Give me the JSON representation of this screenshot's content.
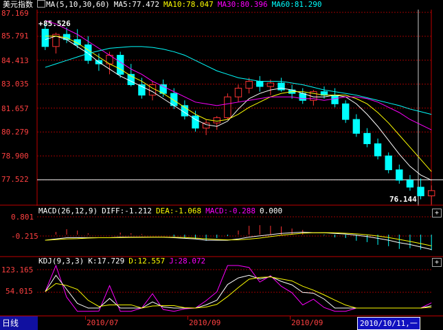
{
  "main_panel": {
    "title": "美元指数",
    "ma_label": "MA(5,10,30,60)",
    "ma5": "MA5:77.472",
    "ma10": "MA10:78.047",
    "ma30": "MA30:80.396",
    "ma60": "MA60:81.290",
    "y_ticks": [
      "87.169",
      "85.791",
      "84.413",
      "83.035",
      "81.657",
      "80.279",
      "78.900",
      "77.522"
    ],
    "high_label": "85.526",
    "last_label": "76.144",
    "current_value": 77.522
  },
  "macd_panel": {
    "label": "MACD(26,12,9)",
    "diff": "DIFF:-1.212",
    "dea": "DEA:-1.068",
    "macd": "MACD:-0.288",
    "extra": "0.000",
    "y_ticks": [
      "0.801",
      "-0.215"
    ]
  },
  "kdj_panel": {
    "label": "KDJ(9,3,3)",
    "k": "K:17.729",
    "d": "D:12.557",
    "j": "J:28.072",
    "y_ticks": [
      "123.165",
      "54.015"
    ]
  },
  "bottom_bar": {
    "period": "日线",
    "dates": [
      "2010/07",
      "2010/09",
      "2010/09"
    ],
    "cursor_date": "2010/10/11,一"
  },
  "controls": {
    "plus1": "+",
    "plus2": "+"
  },
  "colors": {
    "up": "#ff3333",
    "down": "#00ffff",
    "ma5": "#ffffff",
    "ma10": "#ffff00",
    "ma30": "#ff00ff",
    "ma60": "#00ffff",
    "grid": "#a00000",
    "axis": "#c00000"
  },
  "chart_data": {
    "type": "candlestick",
    "series": [
      {
        "name": "MA5",
        "values": [
          85.6,
          85.8,
          85.6,
          85.2,
          84.8,
          84.3,
          83.9,
          83.5,
          83.2,
          82.9,
          82.6,
          82.2,
          81.8,
          81.4,
          81.0,
          80.7,
          80.6,
          80.9,
          81.6,
          82.2,
          82.5,
          82.7,
          82.8,
          82.7,
          82.5,
          82.3,
          82.3,
          82.4,
          82.3,
          81.9,
          81.3,
          80.6,
          79.8,
          79.0,
          78.3,
          77.8,
          77.5
        ]
      },
      {
        "name": "MA10",
        "values": [
          85.8,
          85.8,
          85.7,
          85.4,
          85.0,
          84.6,
          84.2,
          83.9,
          83.5,
          83.2,
          82.8,
          82.5,
          82.1,
          81.7,
          81.3,
          81.0,
          80.9,
          81.0,
          81.3,
          81.7,
          82.0,
          82.3,
          82.5,
          82.6,
          82.6,
          82.5,
          82.4,
          82.4,
          82.4,
          82.2,
          81.9,
          81.4,
          80.8,
          80.1,
          79.4,
          78.7,
          78.0
        ]
      },
      {
        "name": "MA30",
        "values": [
          86.7,
          86.5,
          86.2,
          85.9,
          85.5,
          85.1,
          84.7,
          84.3,
          83.9,
          83.6,
          83.2,
          82.9,
          82.6,
          82.3,
          82.0,
          81.9,
          81.8,
          81.9,
          82.0,
          82.1,
          82.2,
          82.3,
          82.3,
          82.3,
          82.2,
          82.2,
          82.1,
          82.2,
          82.3,
          82.3,
          82.2,
          82.0,
          81.7,
          81.4,
          81.0,
          80.7,
          80.4
        ]
      },
      {
        "name": "MA60",
        "values": [
          84.0,
          84.2,
          84.4,
          84.6,
          84.8,
          84.95,
          85.1,
          85.15,
          85.2,
          85.2,
          85.15,
          85.05,
          84.9,
          84.7,
          84.4,
          84.1,
          83.8,
          83.6,
          83.4,
          83.3,
          83.2,
          83.2,
          83.2,
          83.1,
          83.0,
          82.85,
          82.7,
          82.6,
          82.5,
          82.4,
          82.25,
          82.1,
          81.95,
          81.8,
          81.6,
          81.45,
          81.29
        ]
      }
    ],
    "candles": [
      [
        86.2,
        86.5,
        85.0,
        85.2
      ],
      [
        85.2,
        86.0,
        84.8,
        85.9
      ],
      [
        85.9,
        86.3,
        85.4,
        85.6
      ],
      [
        85.6,
        86.2,
        85.1,
        85.3
      ],
      [
        85.3,
        85.8,
        84.2,
        84.4
      ],
      [
        84.4,
        84.8,
        83.8,
        84.2
      ],
      [
        84.2,
        84.9,
        83.6,
        84.7
      ],
      [
        84.7,
        84.9,
        83.4,
        83.6
      ],
      [
        83.6,
        84.2,
        82.9,
        83.0
      ],
      [
        83.0,
        83.4,
        82.2,
        82.4
      ],
      [
        82.4,
        83.2,
        82.1,
        83.0
      ],
      [
        83.0,
        83.3,
        82.3,
        82.5
      ],
      [
        82.5,
        82.8,
        81.6,
        81.8
      ],
      [
        81.8,
        82.1,
        81.0,
        81.2
      ],
      [
        81.2,
        81.5,
        80.3,
        80.5
      ],
      [
        80.5,
        81.0,
        80.1,
        80.8
      ],
      [
        80.8,
        81.2,
        80.4,
        81.1
      ],
      [
        81.1,
        82.5,
        81.0,
        82.3
      ],
      [
        82.3,
        83.0,
        82.0,
        82.8
      ],
      [
        82.8,
        83.4,
        82.5,
        83.2
      ],
      [
        83.2,
        83.5,
        82.6,
        82.9
      ],
      [
        82.9,
        83.3,
        82.4,
        83.1
      ],
      [
        83.1,
        83.4,
        82.6,
        82.7
      ],
      [
        82.7,
        83.0,
        82.2,
        82.5
      ],
      [
        82.5,
        82.8,
        81.9,
        82.1
      ],
      [
        82.1,
        82.7,
        81.8,
        82.6
      ],
      [
        82.6,
        82.9,
        82.2,
        82.4
      ],
      [
        82.4,
        82.8,
        81.7,
        81.9
      ],
      [
        81.9,
        82.1,
        80.8,
        81.0
      ],
      [
        81.0,
        81.3,
        80.0,
        80.2
      ],
      [
        80.2,
        80.5,
        79.4,
        79.6
      ],
      [
        79.6,
        79.9,
        78.7,
        78.9
      ],
      [
        78.9,
        79.1,
        77.9,
        78.1
      ],
      [
        78.1,
        78.4,
        77.3,
        77.5
      ],
      [
        77.5,
        77.8,
        76.9,
        77.1
      ],
      [
        77.1,
        77.6,
        76.4,
        76.6
      ],
      [
        76.6,
        77.2,
        76.1,
        76.9
      ]
    ],
    "ylim": [
      76.144,
      87.169
    ],
    "macd": {
      "diff": -1.212,
      "dea": -1.068,
      "macd": -0.288
    },
    "kdj": {
      "k": 17.729,
      "d": 12.557,
      "j": 28.072
    }
  }
}
